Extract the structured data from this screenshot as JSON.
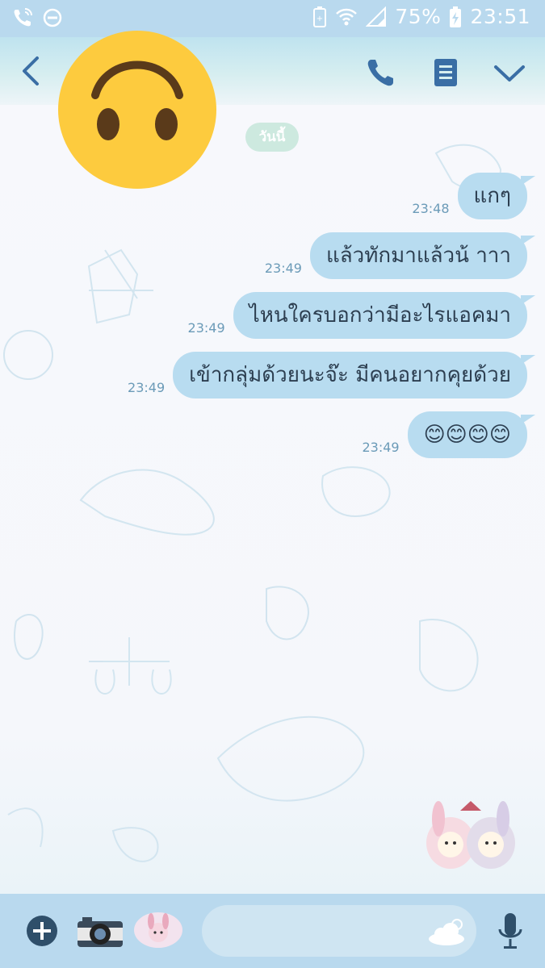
{
  "status_bar": {
    "battery_percent": "75%",
    "time": "23:51",
    "icons": [
      "wifi-call-icon",
      "do-not-disturb-icon",
      "battery-saver-icon",
      "wifi-icon",
      "signal-icon",
      "battery-charging-icon"
    ]
  },
  "header": {
    "icons": [
      "back-icon",
      "phone-icon",
      "note-icon",
      "chevron-down-icon"
    ],
    "avatar": "upside-down-face-emoji"
  },
  "chat": {
    "date_label": "วันนี้",
    "messages": [
      {
        "text": "แกๆ",
        "time": "23:48"
      },
      {
        "text": "แล้วทักมาแล้วน้ าาา",
        "time": "23:49"
      },
      {
        "text": "ไหนใครบอกว่ามีอะไรแอคมา",
        "time": "23:49"
      },
      {
        "text": "เข้ากลุ่มด้วยนะจ๊ะ มีคนอยากคุยด้วย",
        "time": "23:49"
      },
      {
        "text": "😊😊😊😊",
        "time": "23:49"
      }
    ],
    "colors": {
      "bubble": "#b8dcf0",
      "time": "#6b9bb8",
      "date_pill": "#cde9df"
    }
  },
  "input_bar": {
    "placeholder": "",
    "icons": [
      "plus-icon",
      "camera-icon",
      "sticker-icon",
      "cloud-icon",
      "mic-icon"
    ]
  },
  "theme": {
    "bar": "#b9d9ee",
    "accent": "#3a6ea5"
  }
}
